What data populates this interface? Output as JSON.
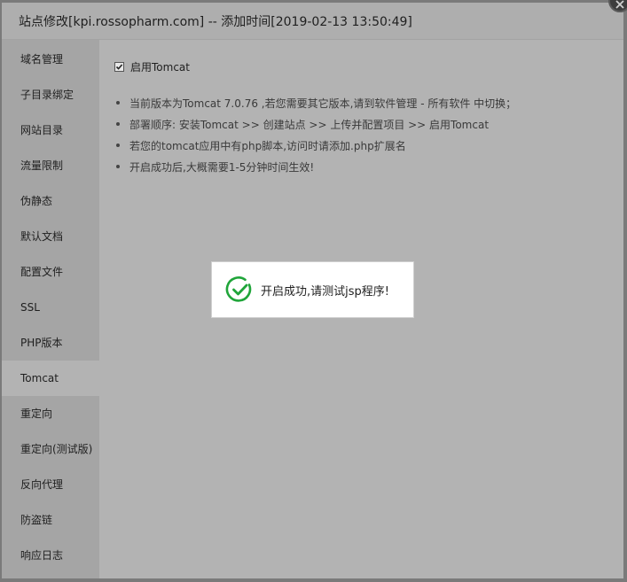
{
  "dialog": {
    "title": "站点修改[kpi.rossopharm.com] -- 添加时间[2019-02-13 13:50:49]"
  },
  "sidebar": {
    "items": [
      {
        "label": "域名管理"
      },
      {
        "label": "子目录绑定"
      },
      {
        "label": "网站目录"
      },
      {
        "label": "流量限制"
      },
      {
        "label": "伪静态"
      },
      {
        "label": "默认文档"
      },
      {
        "label": "配置文件"
      },
      {
        "label": "SSL"
      },
      {
        "label": "PHP版本"
      },
      {
        "label": "Tomcat"
      },
      {
        "label": "重定向"
      },
      {
        "label": "重定向(测试版)"
      },
      {
        "label": "反向代理"
      },
      {
        "label": "防盗链"
      },
      {
        "label": "响应日志"
      }
    ],
    "active": "Tomcat"
  },
  "tomcat": {
    "enable_label": "启用Tomcat",
    "enabled": true,
    "notes": [
      "当前版本为Tomcat 7.0.76 ,若您需要其它版本,请到软件管理 - 所有软件 中切换；",
      "部署顺序: 安装Tomcat >> 创建站点 >> 上传并配置项目 >> 启用Tomcat",
      "若您的tomcat应用中有php脚本,访问时请添加.php扩展名",
      "开启成功后,大概需要1-5分钟时间生效!"
    ]
  },
  "toast": {
    "message": "开启成功,请测试jsp程序!",
    "icon": "check-circle-icon",
    "color": "#20a53a"
  }
}
